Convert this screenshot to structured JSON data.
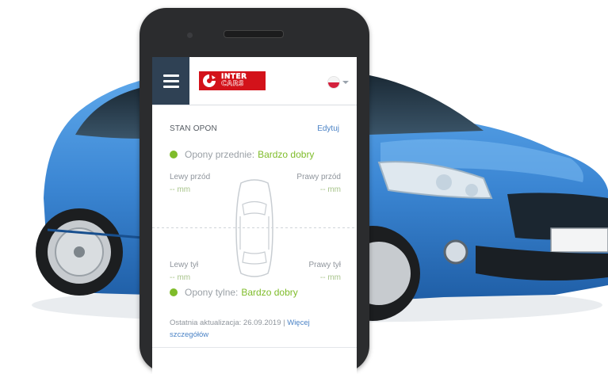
{
  "header": {
    "menu_icon": "hamburger-icon",
    "logo_line1": "INTER",
    "logo_line2": "CARS",
    "language_flag": "poland-flag-icon"
  },
  "tyres": {
    "title": "STAN OPON",
    "edit_label": "Edytuj",
    "front": {
      "label": "Opony przednie:",
      "value": "Bardzo dobry",
      "color": "#7fbc2a"
    },
    "rear": {
      "label": "Opony tylne:",
      "value": "Bardzo dobry",
      "color": "#7fbc2a"
    },
    "front_left": {
      "label": "Lewy przód",
      "value": "-- mm"
    },
    "front_right": {
      "label": "Prawy przód",
      "value": "-- mm"
    },
    "rear_left": {
      "label": "Lewy tył",
      "value": "-- mm"
    },
    "rear_right": {
      "label": "Prawy tył",
      "value": "-- mm"
    }
  },
  "footer": {
    "updated_text": "Ostatnia aktualizacja: 26.09.2019 |",
    "more_link": "Więcej szczegółów"
  },
  "colors": {
    "header_menu": "#2f4154",
    "brand_red": "#d3121a",
    "link": "#4b83c6",
    "good": "#7fbc2a"
  }
}
